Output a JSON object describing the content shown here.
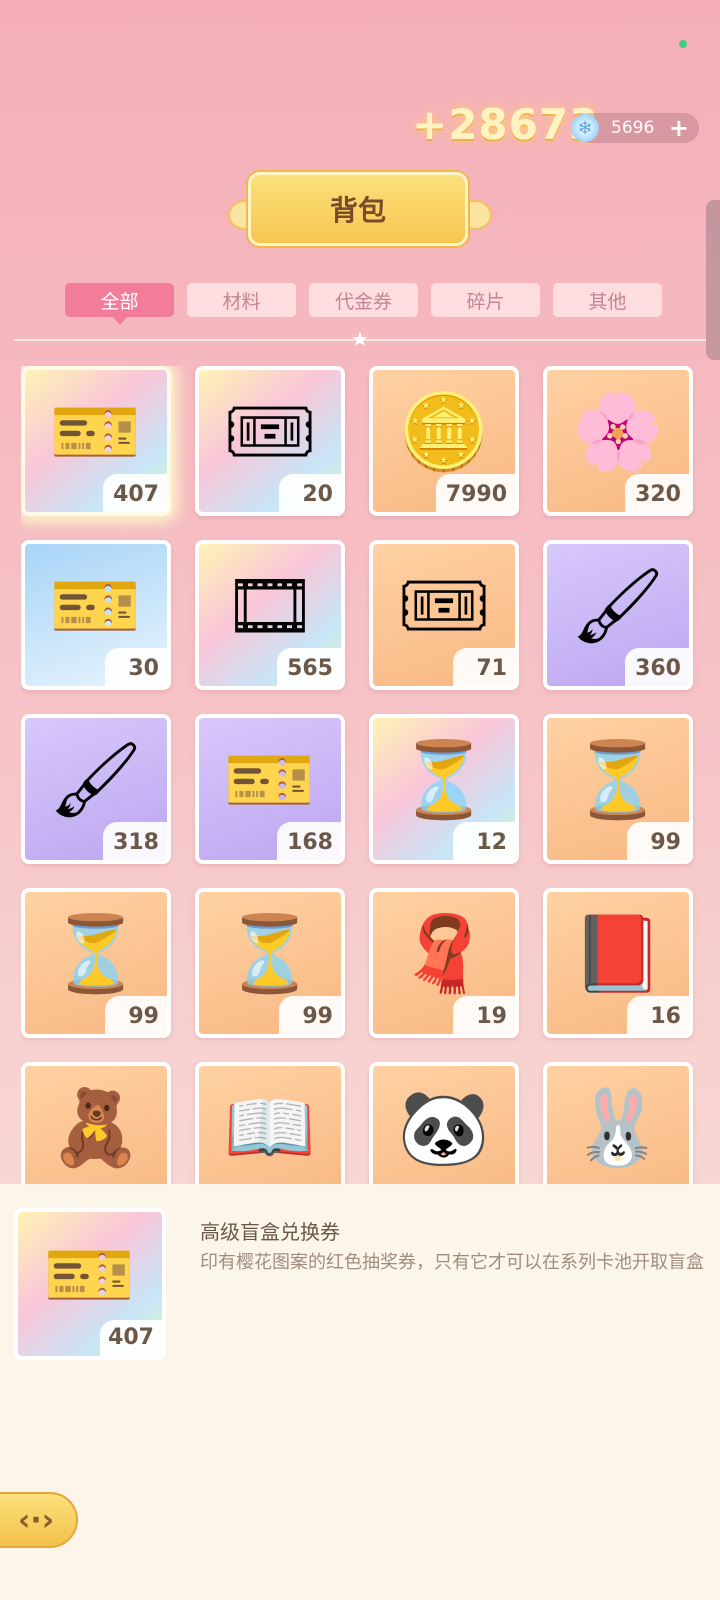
{
  "header": {
    "reward_popup": "+28673",
    "currency": {
      "value": "5696",
      "gem_icon": "gem-icon",
      "plus_icon": "plus-icon"
    },
    "title": "背包"
  },
  "tabs": [
    {
      "label": "全部",
      "active": true
    },
    {
      "label": "材料",
      "active": false
    },
    {
      "label": "代金券",
      "active": false
    },
    {
      "label": "碎片",
      "active": false
    },
    {
      "label": "其他",
      "active": false
    }
  ],
  "items": [
    {
      "icon": "🎫",
      "count": "407",
      "bg": "rainbow",
      "selected": true
    },
    {
      "icon": "🎟",
      "count": "20",
      "bg": "rainbow"
    },
    {
      "icon": "🪙",
      "count": "7990",
      "bg": "orange"
    },
    {
      "icon": "🌸",
      "count": "320",
      "bg": "orange"
    },
    {
      "icon": "🎫",
      "count": "30",
      "bg": "blue"
    },
    {
      "icon": "🎞",
      "count": "565",
      "bg": "rainbow"
    },
    {
      "icon": "🎟",
      "count": "71",
      "bg": "orange"
    },
    {
      "icon": "🖌",
      "count": "360",
      "bg": "purple"
    },
    {
      "icon": "🖌",
      "count": "318",
      "bg": "purple"
    },
    {
      "icon": "🎫",
      "count": "168",
      "bg": "purple"
    },
    {
      "icon": "⏳",
      "count": "12",
      "bg": "rainbow"
    },
    {
      "icon": "⏳",
      "count": "99",
      "bg": "orange"
    },
    {
      "icon": "⏳",
      "count": "99",
      "bg": "orange"
    },
    {
      "icon": "⏳",
      "count": "99",
      "bg": "orange"
    },
    {
      "icon": "🧣",
      "count": "19",
      "bg": "orange"
    },
    {
      "icon": "📕",
      "count": "16",
      "bg": "orange"
    },
    {
      "icon": "🧸",
      "count": "",
      "bg": "orange"
    },
    {
      "icon": "📖",
      "count": "",
      "bg": "orange"
    },
    {
      "icon": "🐼",
      "count": "",
      "bg": "orange"
    },
    {
      "icon": "🐰",
      "count": "",
      "bg": "orange"
    }
  ],
  "detail": {
    "count": "407",
    "name": "高级盲盒兑换券",
    "description": "印有樱花图案的红色抽奖券，只有它才可以在系列卡池开取盲盒"
  },
  "back_button": {
    "icon": "back-arrow-icon",
    "glyph": "‹·›"
  }
}
